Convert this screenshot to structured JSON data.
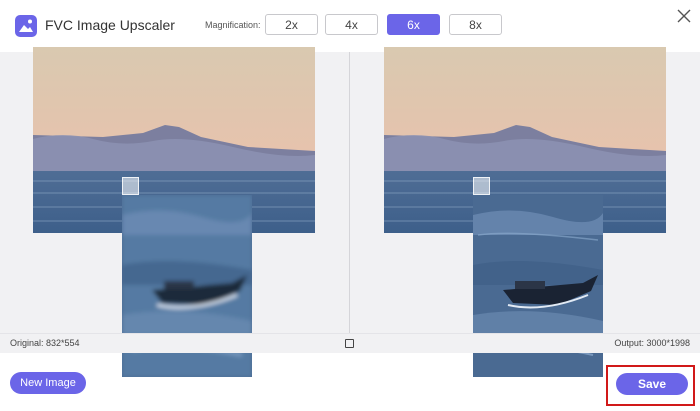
{
  "app": {
    "title": "FVC Image Upscaler",
    "logo_icon": "image-upscale-icon",
    "accent_color": "#6b65e8"
  },
  "magnification": {
    "label": "Magnification:",
    "options": [
      "2x",
      "4x",
      "6x",
      "8x"
    ],
    "selected": "6x"
  },
  "window": {
    "close_icon": "close-icon"
  },
  "preview": {
    "original_label": "Original: 832*554",
    "output_label": "Output: 3000*1998",
    "compare_icon": "square-icon"
  },
  "actions": {
    "new_image_label": "New Image",
    "save_label": "Save",
    "highlight_color": "#d11919"
  }
}
